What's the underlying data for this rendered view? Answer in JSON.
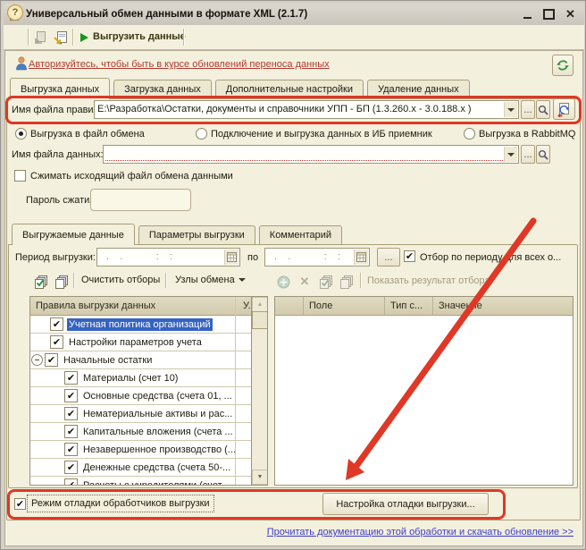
{
  "window": {
    "title": "Универсальный обмен данными в формате XML (2.1.7)"
  },
  "toolbar": {
    "help_label": "?",
    "upload_label": "Выгрузить данные"
  },
  "auth": {
    "link": "Авторизуйтесь, чтобы быть в курсе обновлений переноса данных"
  },
  "main_tabs": [
    {
      "label": "Выгрузка данных",
      "active": true
    },
    {
      "label": "Загрузка данных",
      "active": false
    },
    {
      "label": "Дополнительные настройки",
      "active": false
    },
    {
      "label": "Удаление данных",
      "active": false
    }
  ],
  "rules_file": {
    "label": "Имя файла правил:",
    "value": "E:\\Разработка\\Остатки, документы и справочники УПП - БП (1.3.260.x - 3.0.188.x )",
    "ellipsis": "..."
  },
  "modes": [
    {
      "label": "Выгрузка в файл обмена",
      "selected": true
    },
    {
      "label": "Подключение и выгрузка данных в ИБ приемник",
      "selected": false
    },
    {
      "label": "Выгрузка в RabbitMQ",
      "selected": false
    }
  ],
  "data_file": {
    "label": "Имя файла данных:",
    "value": "",
    "ellipsis": "..."
  },
  "compress": {
    "label": "Сжимать исходящий файл обмена данными",
    "checked": false
  },
  "password": {
    "label": "Пароль сжатия:",
    "value": ""
  },
  "inner_tabs": [
    {
      "label": "Выгружаемые данные",
      "active": true
    },
    {
      "label": "Параметры выгрузки",
      "active": false
    },
    {
      "label": "Комментарий",
      "active": false
    }
  ],
  "period": {
    "label": "Период выгрузки:",
    "from_mask": " .  .       :  :",
    "to_label": "по",
    "to_mask": " .  .       :  :",
    "ellipsis": "...",
    "filter_label": "Отбор по периоду для всех о...",
    "filter_checked": true
  },
  "filters_toolbar": {
    "clear_label": "Очистить отборы",
    "nodes_label": "Узлы обмена",
    "show_result_label": "Показать результат отбора"
  },
  "rules_table": {
    "title": "Правила выгрузки данных",
    "col2": "У...",
    "rows": [
      {
        "label": "Учетная политика организаций",
        "level": 1,
        "checked": true,
        "selected": true,
        "expander": false
      },
      {
        "label": "Настройки параметров учета",
        "level": 1,
        "checked": true,
        "selected": false,
        "expander": false
      },
      {
        "label": "Начальные остатки",
        "level": 1,
        "checked": true,
        "selected": false,
        "expander": true
      },
      {
        "label": "Материалы (счет 10)",
        "level": 2,
        "checked": true,
        "selected": false,
        "expander": false
      },
      {
        "label": "Основные средства (счета 01, ...",
        "level": 2,
        "checked": true,
        "selected": false,
        "expander": false
      },
      {
        "label": "Нематериальные активы и рас...",
        "level": 2,
        "checked": true,
        "selected": false,
        "expander": false
      },
      {
        "label": "Капитальные вложения (счета ...",
        "level": 2,
        "checked": true,
        "selected": false,
        "expander": false
      },
      {
        "label": "Незавершенное производство (...",
        "level": 2,
        "checked": true,
        "selected": false,
        "expander": false
      },
      {
        "label": "Денежные средства (счета 50-...",
        "level": 2,
        "checked": true,
        "selected": false,
        "expander": false
      },
      {
        "label": "Расчеты с учредителями (счет ...",
        "level": 2,
        "checked": true,
        "selected": false,
        "expander": false
      }
    ]
  },
  "filter_table": {
    "headers": [
      "Поле",
      "Тип с...",
      "Значение"
    ]
  },
  "debug": {
    "checkbox_label": "Режим отладки обработчиков выгрузки",
    "checked": true,
    "button_label": "Настройка отладки выгрузки..."
  },
  "footer": {
    "doc_link": "Прочитать документацию этой обработки и скачать обновление >>"
  },
  "colors": {
    "annotation": "#DF3826",
    "selection": "#3563C1",
    "link_top": "#AF3A2F",
    "link_bottom": "#3C3CC8"
  }
}
